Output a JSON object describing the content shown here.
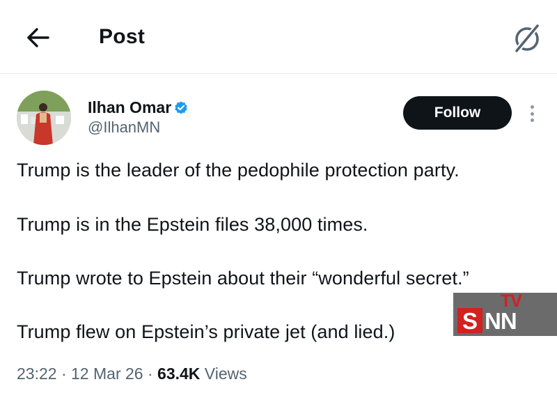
{
  "header": {
    "title": "Post",
    "back_icon": "arrow-left-icon",
    "grok_icon": "grok-slash-circle-icon"
  },
  "author": {
    "display_name": "Ilhan Omar",
    "handle": "@IlhanMN",
    "verified": true,
    "verified_color": "#1d9bf0"
  },
  "actions": {
    "follow_label": "Follow",
    "more_icon": "vertical-dots-icon"
  },
  "tweet": {
    "lines": [
      "Trump is the leader of the pedophile protection party.",
      "Trump is in the Epstein files 38,000 times.",
      "Trump wrote to Epstein about their “wonderful secret.”",
      "Trump flew on Epstein’s private jet (and lied.)"
    ]
  },
  "meta": {
    "time": "23:22",
    "separator": "·",
    "date": "12 Mar 26",
    "views_count": "63.4K",
    "views_label": "Views"
  },
  "watermark": {
    "letters_main": "NN",
    "letter_s": "S",
    "letters_tv": "TV",
    "red": "#d32020",
    "grey": "#6b6b6b"
  },
  "colors": {
    "text": "#0f1419",
    "secondary": "#536471",
    "follow_bg": "#0f1419"
  }
}
